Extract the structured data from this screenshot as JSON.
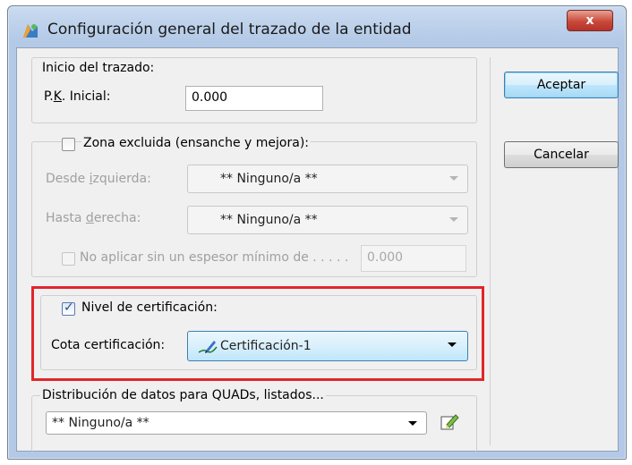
{
  "window": {
    "title": "Configuración general del trazado de la entidad",
    "close_label": "x"
  },
  "inicio": {
    "group_title": "Inicio del trazado:",
    "pk_label_pre": "P.",
    "pk_label_ul": "K",
    "pk_label_post": ". Inicial:",
    "pk_value": "0.000"
  },
  "zona": {
    "checkbox_label": "Zona excluida  (ensanche y mejora):",
    "checked": false,
    "desde_label_pre": "Desde ",
    "desde_label_ul": "i",
    "desde_label_post": "zquierda:",
    "desde_value": "** Ninguno/a **",
    "hasta_label_pre": "Hasta ",
    "hasta_label_ul": "d",
    "hasta_label_post": "erecha:",
    "hasta_value": "** Ninguno/a **",
    "no_aplicar_label": "No aplicar sin un espesor mínimo de . . . . .",
    "espesor_value": "0.000"
  },
  "nivel": {
    "checkbox_label": "Nivel de certificación:",
    "checked": true,
    "cota_label": "Cota certificación:",
    "cota_value": "Certificación-1"
  },
  "distribucion": {
    "group_title": "Distribución de datos para QUADs, listados...",
    "value": "** Ninguno/a **"
  },
  "buttons": {
    "accept": "Aceptar",
    "cancel": "Cancelar"
  },
  "colors": {
    "highlight": "#e0262b",
    "default_button": "#3c7fb1"
  }
}
